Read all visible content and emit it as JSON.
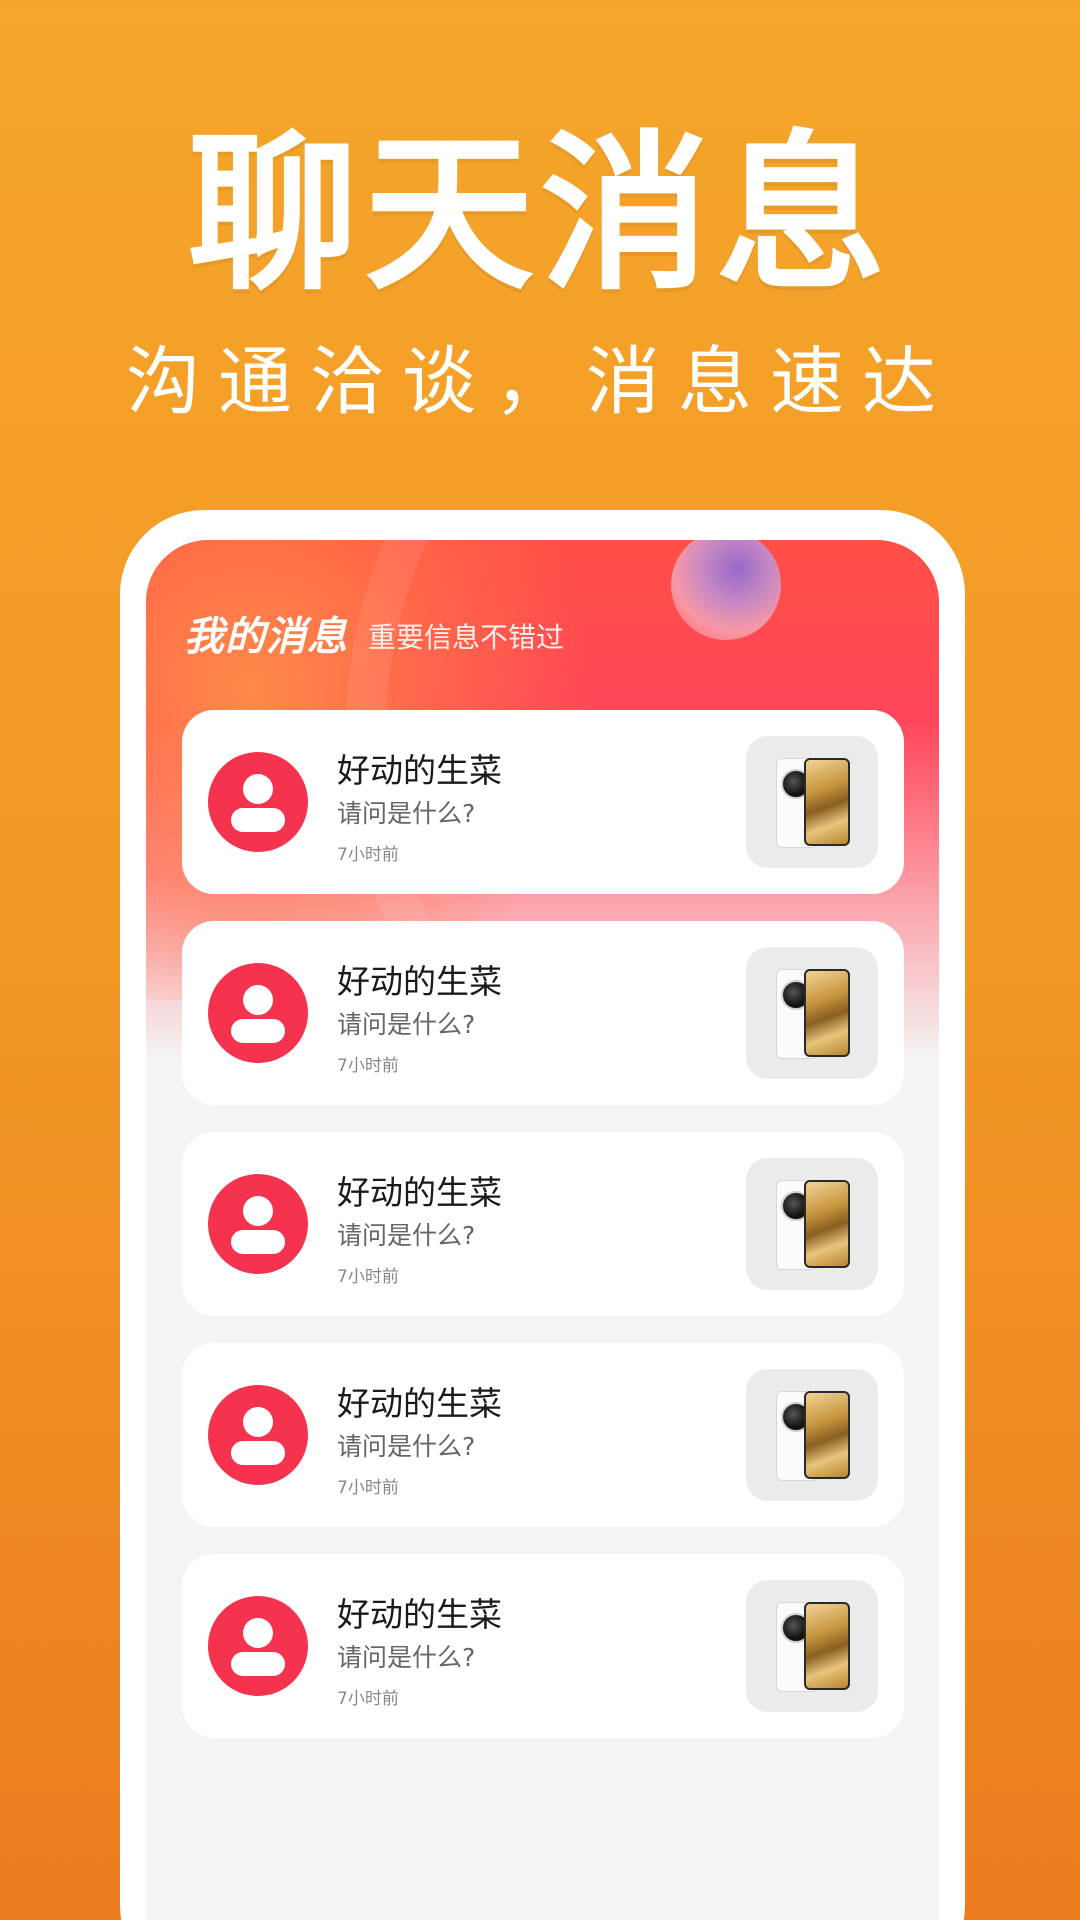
{
  "promo": {
    "title": "聊天消息",
    "subtitle": "沟通洽谈，消息速达"
  },
  "screen": {
    "section_title": "我的消息",
    "section_subtitle": "重要信息不错过"
  },
  "messages": [
    {
      "name": "好动的生菜",
      "preview": "请问是什么?",
      "time": "7小时前",
      "avatar_icon": "user-avatar-icon",
      "thumb": "phone-product-image"
    },
    {
      "name": "好动的生菜",
      "preview": "请问是什么?",
      "time": "7小时前",
      "avatar_icon": "user-avatar-icon",
      "thumb": "phone-product-image"
    },
    {
      "name": "好动的生菜",
      "preview": "请问是什么?",
      "time": "7小时前",
      "avatar_icon": "user-avatar-icon",
      "thumb": "phone-product-image"
    },
    {
      "name": "好动的生菜",
      "preview": "请问是什么?",
      "time": "7小时前",
      "avatar_icon": "user-avatar-icon",
      "thumb": "phone-product-image"
    },
    {
      "name": "好动的生菜",
      "preview": "请问是什么?",
      "time": "7小时前",
      "avatar_icon": "user-avatar-icon",
      "thumb": "phone-product-image"
    }
  ],
  "colors": {
    "background": "#f29a27",
    "avatar": "#f5334e",
    "header_gradient": "#ff4a5a"
  }
}
